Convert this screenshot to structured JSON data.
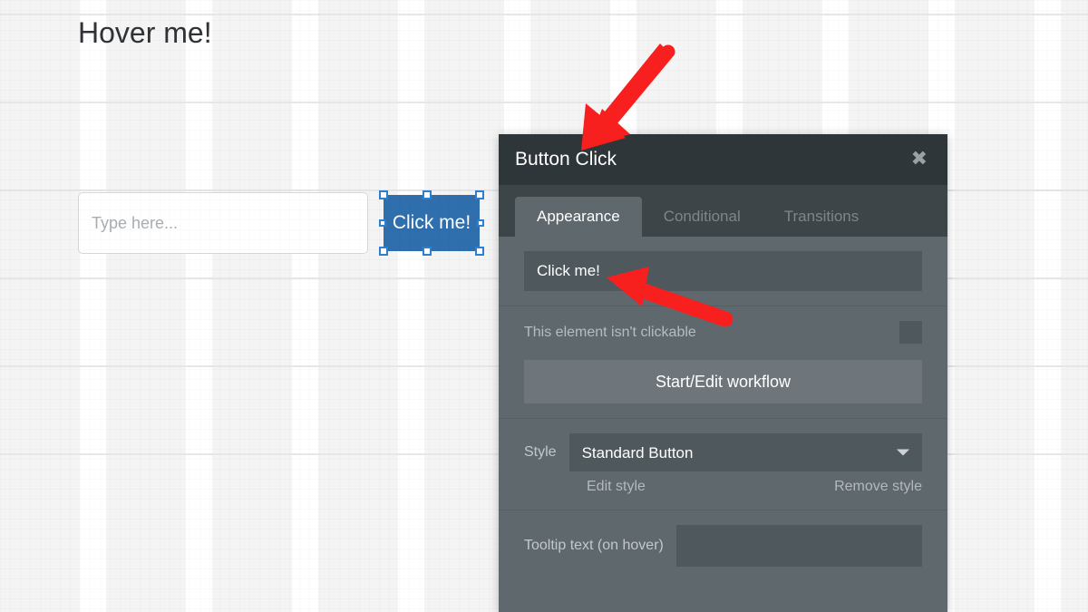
{
  "canvas": {
    "heading": "Hover me!",
    "text_input_placeholder": "Type here...",
    "text_input_value": "",
    "button_label": "Click me!",
    "button_color": "#2f6fad",
    "selection_handle_color": "#2f7fd0"
  },
  "panel": {
    "title": "Button Click",
    "close_icon": "✖",
    "header_color": "#2e3639",
    "body_color": "#5f686d",
    "tabs": [
      {
        "label": "Appearance",
        "active": true
      },
      {
        "label": "Conditional",
        "active": false
      },
      {
        "label": "Transitions",
        "active": false
      }
    ],
    "label_field": {
      "value": "Click me!",
      "placeholder": ""
    },
    "clickable": {
      "label": "This element isn't clickable",
      "checked": false
    },
    "workflow_button": "Start/Edit workflow",
    "style": {
      "label": "Style",
      "selected": "Standard Button",
      "options": [
        "Standard Button"
      ],
      "edit_link": "Edit style",
      "remove_link": "Remove style"
    },
    "tooltip": {
      "label": "Tooltip text (on hover)",
      "value": "",
      "placeholder": ""
    }
  },
  "annotations": {
    "arrow_color": "#f81f1f",
    "arrows": [
      {
        "name": "arrow-to-panel-title",
        "direction": "down-left"
      },
      {
        "name": "arrow-to-label-field",
        "direction": "up-left"
      }
    ]
  }
}
